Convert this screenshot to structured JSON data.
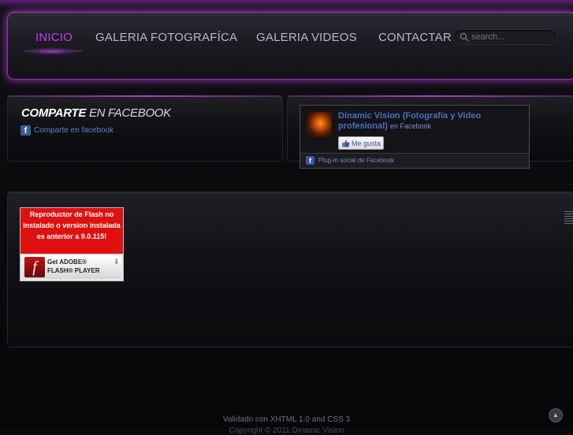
{
  "nav": {
    "items": [
      {
        "label": "INICIO",
        "active": true
      },
      {
        "label": "GALERIA FOTOGRAFÍCA",
        "active": false
      },
      {
        "label": "GALERIA VIDEOS",
        "active": false
      },
      {
        "label": "CONTACTAR",
        "active": false
      }
    ],
    "search": {
      "placeholder": "search..."
    }
  },
  "share_panel": {
    "title_bold": "COMPARTE",
    "title_rest": "EN FACEBOOK",
    "link_text": "Comparte en facebook"
  },
  "fb_like_box": {
    "page_name": "Dinamic Vision (Fotografía y Video profesional)",
    "suffix": "en Facebook",
    "like_button": "Me gusta",
    "footer": "Plug-in social de Facebook"
  },
  "flash": {
    "message": "Reproductor de Flash no instalado o version instalada es anterior a 9.0.115!",
    "badge_get": "Get ADOBE®",
    "badge_player": "FLASH® PLAYER"
  },
  "footer": {
    "line1": "Validado con XHTML 1.0 and CSS 3",
    "line2": "Copyright © 2011 Dinamic Vision"
  },
  "colors": {
    "accent": "#c43ce8",
    "nav_glow": "#9a2fb8",
    "facebook": "#3b5998",
    "flash_red": "#e01010"
  },
  "icons": [
    "search-icon",
    "facebook-icon",
    "thumbs-up-icon",
    "flash-logo-icon",
    "download-arrow-icon",
    "scroll-top-icon"
  ]
}
